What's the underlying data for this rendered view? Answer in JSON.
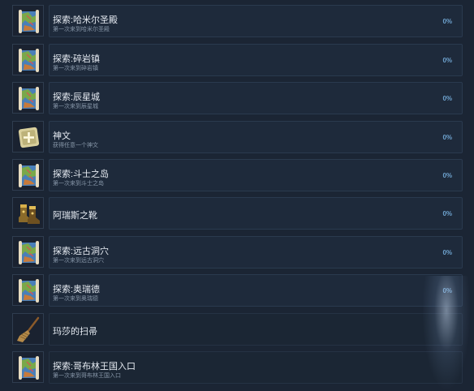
{
  "achievements": [
    {
      "title": "探索:哈米尔圣殿",
      "desc": "第一次来到哈米尔圣殿",
      "percent": "0%",
      "icon": "map-scroll-icon"
    },
    {
      "title": "探索:碎岩镇",
      "desc": "第一次来到碎岩镇",
      "percent": "0%",
      "icon": "map-scroll-icon"
    },
    {
      "title": "探索:辰星城",
      "desc": "第一次来到辰星城",
      "percent": "0%",
      "icon": "map-scroll-icon"
    },
    {
      "title": "神文",
      "desc": "获得任意一个神文",
      "percent": "0%",
      "icon": "rune-tablet-icon"
    },
    {
      "title": "探索:斗士之岛",
      "desc": "第一次来到斗士之岛",
      "percent": "0%",
      "icon": "map-scroll-icon"
    },
    {
      "title": "阿瑞斯之靴",
      "desc": "",
      "percent": "0%",
      "icon": "boots-icon"
    },
    {
      "title": "探索:远古洞穴",
      "desc": "第一次来到远古洞穴",
      "percent": "0%",
      "icon": "map-scroll-icon"
    },
    {
      "title": "探索:奥瑞德",
      "desc": "第一次来到奥瑞德",
      "percent": "0%",
      "icon": "map-scroll-icon"
    },
    {
      "title": "玛莎的扫帚",
      "desc": "",
      "percent": "",
      "icon": "broom-icon"
    },
    {
      "title": "探索:哥布林王国入口",
      "desc": "第一次来到哥布林王国入口",
      "percent": "",
      "icon": "map-scroll-icon"
    }
  ]
}
